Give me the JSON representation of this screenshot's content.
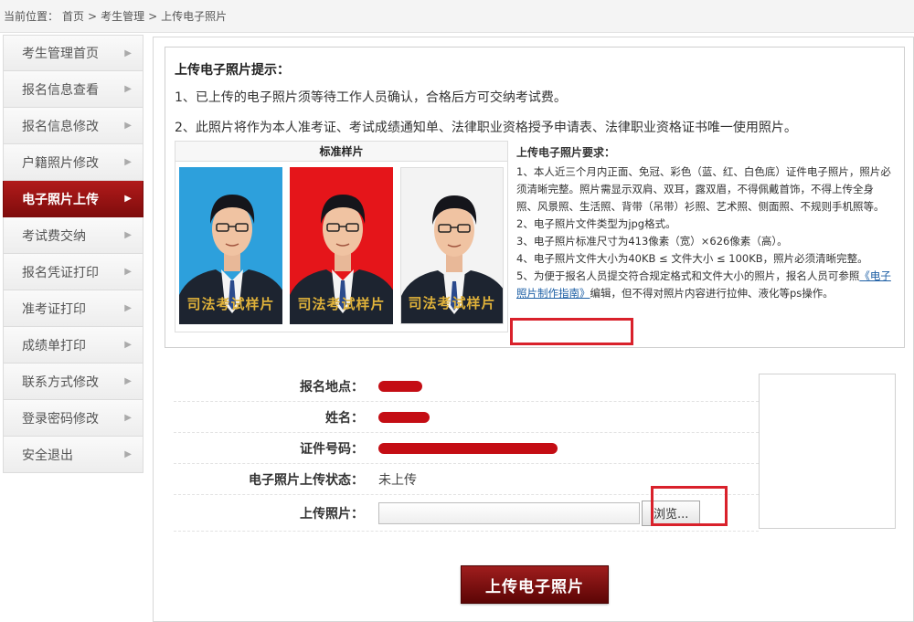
{
  "breadcrumb": {
    "prefix": "当前位置：",
    "home": "首页",
    "sep": ">",
    "section": "考生管理",
    "current": "上传电子照片"
  },
  "sidebar": {
    "items": [
      {
        "label": "考生管理首页"
      },
      {
        "label": "报名信息查看"
      },
      {
        "label": "报名信息修改"
      },
      {
        "label": "户籍照片修改"
      },
      {
        "label": "电子照片上传",
        "active": true
      },
      {
        "label": "考试费交纳"
      },
      {
        "label": "报名凭证打印"
      },
      {
        "label": "准考证打印"
      },
      {
        "label": "成绩单打印"
      },
      {
        "label": "联系方式修改"
      },
      {
        "label": "登录密码修改"
      },
      {
        "label": "安全退出"
      }
    ],
    "arrow": "▶"
  },
  "tips": {
    "title": "上传电子照片提示：",
    "line1": "1、已上传的电子照片须等待工作人员确认，合格后方可交纳考试费。",
    "line2": "2、此照片将作为本人准考证、考试成绩通知单、法律职业资格授予申请表、法律职业资格证书唯一使用照片。"
  },
  "samples": {
    "header": "标准样片",
    "stamp": "司法考试样片"
  },
  "requirements": {
    "title": "上传电子照片要求：",
    "r1": "1、本人近三个月内正面、免冠、彩色（蓝、红、白色底）证件电子照片，照片必须清晰完整。照片需显示双肩、双耳，露双眉，不得佩戴首饰，不得上传全身照、风景照、生活照、背带（吊带）衫照、艺术照、侧面照、不规则手机照等。",
    "r2": "2、电子照片文件类型为jpg格式。",
    "r3": "3、电子照片标准尺寸为413像素（宽）×626像素（高）。",
    "r4": "4、电子照片文件大小为40KB ≤ 文件大小 ≤ 100KB，照片必须清晰完整。",
    "r5_pre": "5、为便于报名人员提交符合规定格式和文件大小的照片，报名人员可参照",
    "r5_link": "《电子照片制作指南》",
    "r5_post": "编辑，但不得对照片内容进行拉伸、液化等ps操作。"
  },
  "form": {
    "location_label": "报名地点：",
    "name_label": "姓名：",
    "id_label": "证件号码：",
    "status_label": "电子照片上传状态：",
    "status_value": "未上传",
    "upload_label": "上传照片：",
    "browse_label": "浏览..."
  },
  "submit_label": "上传电子照片",
  "colors": {
    "accent": "#8b1010",
    "highlight": "#d9212b",
    "redaction": "#c40d14",
    "photo_blue": "#2da0dc",
    "photo_red": "#e5151a",
    "photo_white": "#f3f3f3"
  }
}
